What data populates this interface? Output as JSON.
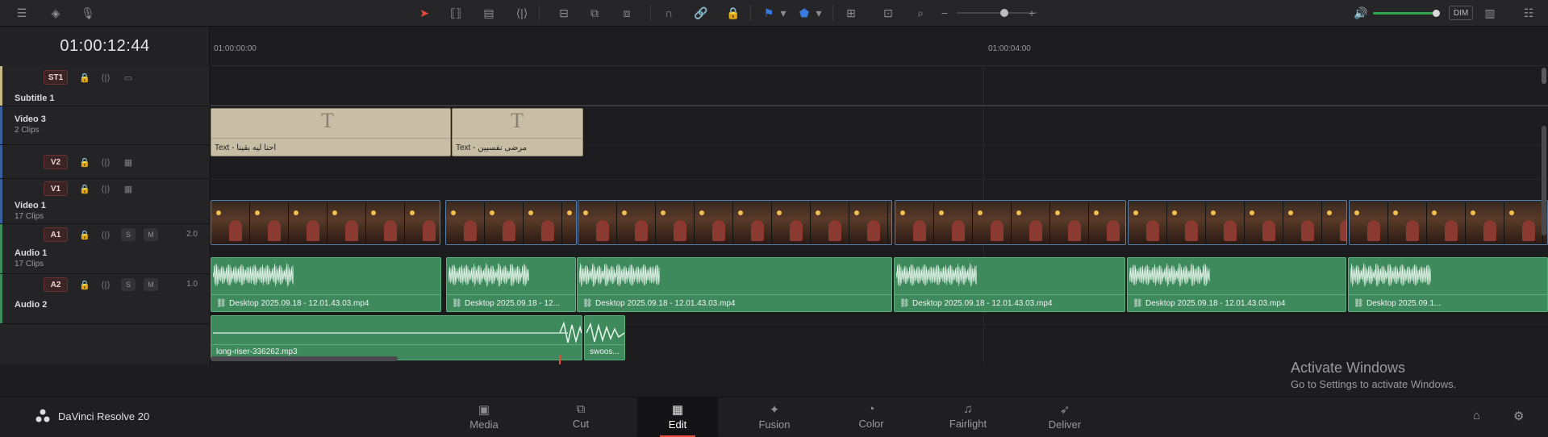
{
  "timecode": "01:00:12:44",
  "ruler": {
    "labels": [
      "01:00:00:00",
      "01:00:04:00"
    ]
  },
  "toolbar": {
    "dim_label": "DIM"
  },
  "tracks": {
    "st1": {
      "badge": "ST1",
      "name": "Subtitle 1"
    },
    "v3": {
      "name": "Video 3",
      "clips": "2 Clips"
    },
    "v2": {
      "badge": "V2"
    },
    "v1": {
      "badge": "V1",
      "name": "Video 1",
      "clips": "17 Clips"
    },
    "a1": {
      "badge": "A1",
      "name": "Audio 1",
      "clips": "17 Clips",
      "volume": "2.0",
      "solo": "S",
      "mute": "M"
    },
    "a2": {
      "badge": "A2",
      "name": "Audio 2",
      "volume": "1.0",
      "solo": "S",
      "mute": "M"
    }
  },
  "clips": {
    "text1": "Text - احنا ليه بقينا",
    "text2": "Text - مرضى نفسيين",
    "audio_a1": [
      "Desktop 2025.09.18 - 12.01.43.03.mp4",
      "Desktop 2025.09.18 - 12...",
      "Desktop 2025.09.18 - 12.01.43.03.mp4",
      "Desktop 2025.09.18 - 12.01.43.03.mp4",
      "Desktop 2025.09.18 - 12.01.43.03.mp4",
      "Desktop 2025.09.1..."
    ],
    "audio_a2": [
      "long-riser-336262.mp3",
      "swoos..."
    ]
  },
  "app_name": "DaVinci Resolve 20",
  "pages": [
    "Media",
    "Cut",
    "Edit",
    "Fusion",
    "Color",
    "Fairlight",
    "Deliver"
  ],
  "active_page": "Edit",
  "watermark": {
    "title": "Activate Windows",
    "subtitle": "Go to Settings to activate Windows."
  },
  "colors": {
    "accent": "#e84b3c",
    "audio": "#3e8a5c",
    "text_clip": "#c7bea5"
  }
}
